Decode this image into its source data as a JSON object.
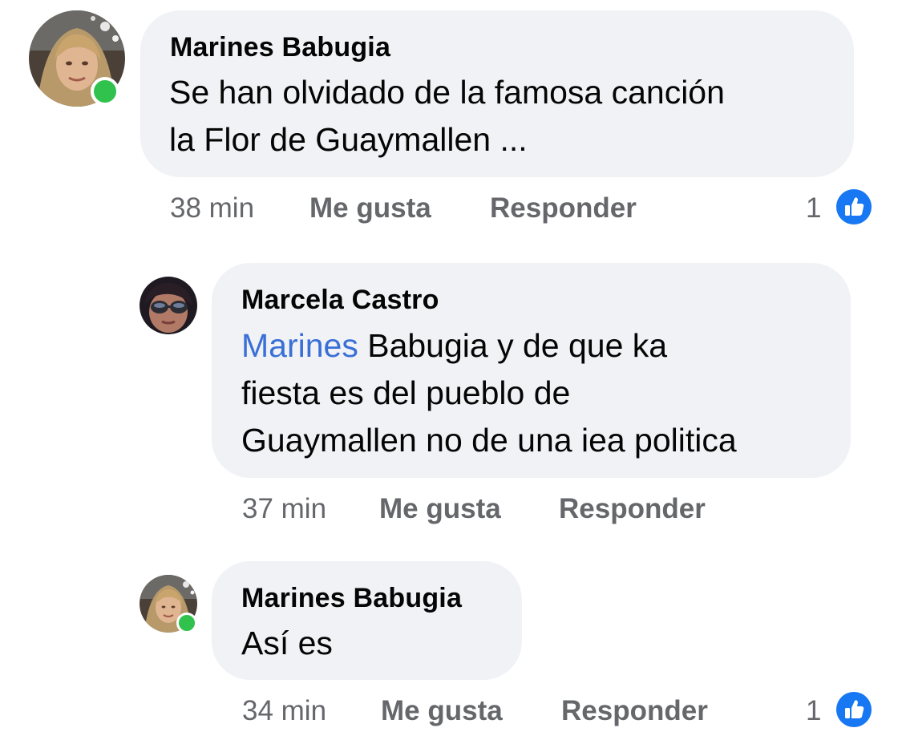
{
  "comments": [
    {
      "author": "Marines Babugia",
      "lines": [
        "Se han olvidado de la famosa canción",
        "la Flor de Guaymallen ..."
      ],
      "time": "38 min",
      "like_label": "Me gusta",
      "reply_label": "Responder",
      "reaction_count": "1",
      "online": true
    },
    {
      "author": "Marcela Castro",
      "mention": "Marines",
      "lines": [
        " Babugia y de que ka",
        "fiesta es del pueblo de",
        "Guaymallen no de una iea politica"
      ],
      "time": "37 min",
      "like_label": "Me gusta",
      "reply_label": "Responder",
      "online": false
    },
    {
      "author": "Marines Babugia",
      "lines": [
        "Así es"
      ],
      "time": "34 min",
      "like_label": "Me gusta",
      "reply_label": "Responder",
      "reaction_count": "1",
      "online": true
    }
  ],
  "colors": {
    "bubble": "#f0f2f5",
    "meta": "#65676b",
    "mention": "#3a6fd6",
    "like_blue": "#1877f2",
    "online": "#31c24d"
  },
  "icons": {
    "reaction": "like-thumbs-up-icon"
  }
}
